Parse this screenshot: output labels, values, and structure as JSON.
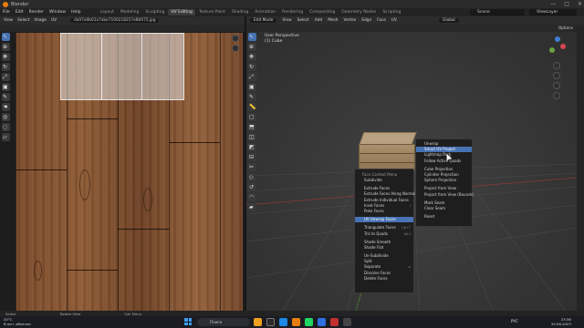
{
  "window": {
    "title": "Blender",
    "controls": [
      "—",
      "□",
      "✕"
    ]
  },
  "topmenu": {
    "items": [
      "File",
      "Edit",
      "Render",
      "Window",
      "Help"
    ],
    "workspaces": [
      "Layout",
      "Modeling",
      "Sculpting",
      "UV Editing",
      "Texture Paint",
      "Shading",
      "Animation",
      "Rendering",
      "Compositing",
      "Geometry Nodes",
      "Scripting"
    ],
    "active_workspace": "UV Editing",
    "scene": "Scene",
    "view_layer": "ViewLayer"
  },
  "uv_editor": {
    "header_items": [
      "View",
      "Select",
      "Image",
      "UV"
    ],
    "image_name": "da97a9b01a7abe7100218257e8b975.jpg"
  },
  "viewport": {
    "mode": "Edit Mode",
    "header_items": [
      "View",
      "Select",
      "Add",
      "Mesh",
      "Vertex",
      "Edge",
      "Face",
      "UV"
    ],
    "orientation": "Global",
    "options_label": "Options",
    "info_line1": "User Perspective",
    "info_line2": "(1) Cube"
  },
  "context_menu": {
    "title": "Face Context Menu",
    "groups": [
      [
        {
          "label": "Subdivide"
        }
      ],
      [
        {
          "label": "Extrude Faces"
        },
        {
          "label": "Extrude Faces Along Normals"
        },
        {
          "label": "Extrude Individual Faces"
        },
        {
          "label": "Inset Faces",
          "shortcut": "I"
        },
        {
          "label": "Poke Faces"
        }
      ],
      [
        {
          "label": "UV Unwrap Faces",
          "shortcut": "▸",
          "active": true
        }
      ],
      [
        {
          "label": "Triangulate Faces",
          "shortcut": "Ctrl T"
        },
        {
          "label": "Tris to Quads",
          "shortcut": "Alt J"
        }
      ],
      [
        {
          "label": "Shade Smooth"
        },
        {
          "label": "Shade Flat"
        }
      ],
      [
        {
          "label": "Un-Subdivide"
        },
        {
          "label": "Split"
        },
        {
          "label": "Separate",
          "shortcut": "▸"
        },
        {
          "label": "Dissolve Faces"
        },
        {
          "label": "Delete Faces"
        }
      ]
    ]
  },
  "uv_submenu": {
    "groups": [
      [
        {
          "label": "Unwrap"
        },
        {
          "label": "Smart UV Project",
          "active": true
        },
        {
          "label": "Lightmap Pack"
        },
        {
          "label": "Follow Active Quads"
        }
      ],
      [
        {
          "label": "Cube Projection"
        },
        {
          "label": "Cylinder Projection"
        },
        {
          "label": "Sphere Projection"
        }
      ],
      [
        {
          "label": "Project from View"
        },
        {
          "label": "Project from View (Bounds)"
        }
      ],
      [
        {
          "label": "Mark Seam"
        },
        {
          "label": "Clear Seam"
        }
      ],
      [
        {
          "label": "Reset"
        }
      ]
    ]
  },
  "statusbar": {
    "items": [
      "Select",
      "Rotate View",
      "Call Menu"
    ]
  },
  "taskbar": {
    "temp": "20°C",
    "weather_text": "В осн. облачно",
    "search_placeholder": "Поиск",
    "time": "23:36",
    "date": "20.06.2023",
    "lang": "РУС"
  },
  "colors": {
    "accent": "#4772b3",
    "blender_orange": "#e87d0d",
    "axis_x": "#d6444f",
    "axis_y": "#6ba33d",
    "axis_z": "#3f7fd6"
  }
}
